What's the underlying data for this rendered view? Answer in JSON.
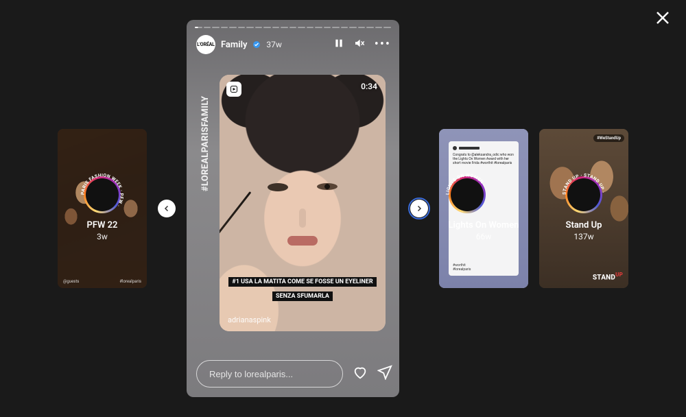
{
  "close_label": "Close",
  "prev_label": "Previous",
  "next_label": "Next",
  "active_story": {
    "username": "Family",
    "verified": true,
    "age": "37w",
    "avatar_text": "L'ORÉAL",
    "segments_total": 23,
    "segments_done": 0,
    "hashtag": "#LOREALPARISFAMILY",
    "clip_time": "0:34",
    "caption": "#1 USA LA MATITA COME SE FOSSE UN EYELINER SENZA SFUMARLA",
    "credit": "adrianaspink",
    "reply_placeholder": "Reply to lorealparis..."
  },
  "previews": {
    "left": [
      {
        "title": "PFW 22",
        "time": "3w",
        "ring": "PARIS FASHION WEEK · PFW ·",
        "tag_left": "@guests",
        "tag_right": "#lorealparis"
      }
    ],
    "right": [
      {
        "title": "Lights On Women",
        "time": "66w",
        "ring": "LIGHTS ON WOMEN ·",
        "blurb": "Congrats to @aleksandra_odic who won the Lights On Women Award with her short movie Frida #worthit #lorealparis",
        "tags": "#worthit\n#lorealparis"
      },
      {
        "title": "Stand Up",
        "time": "137w",
        "ring": "STAND UP · STAND UP ·",
        "pill": "#WeStandUp",
        "logo_main": "STAND",
        "logo_up": "UP"
      }
    ]
  }
}
